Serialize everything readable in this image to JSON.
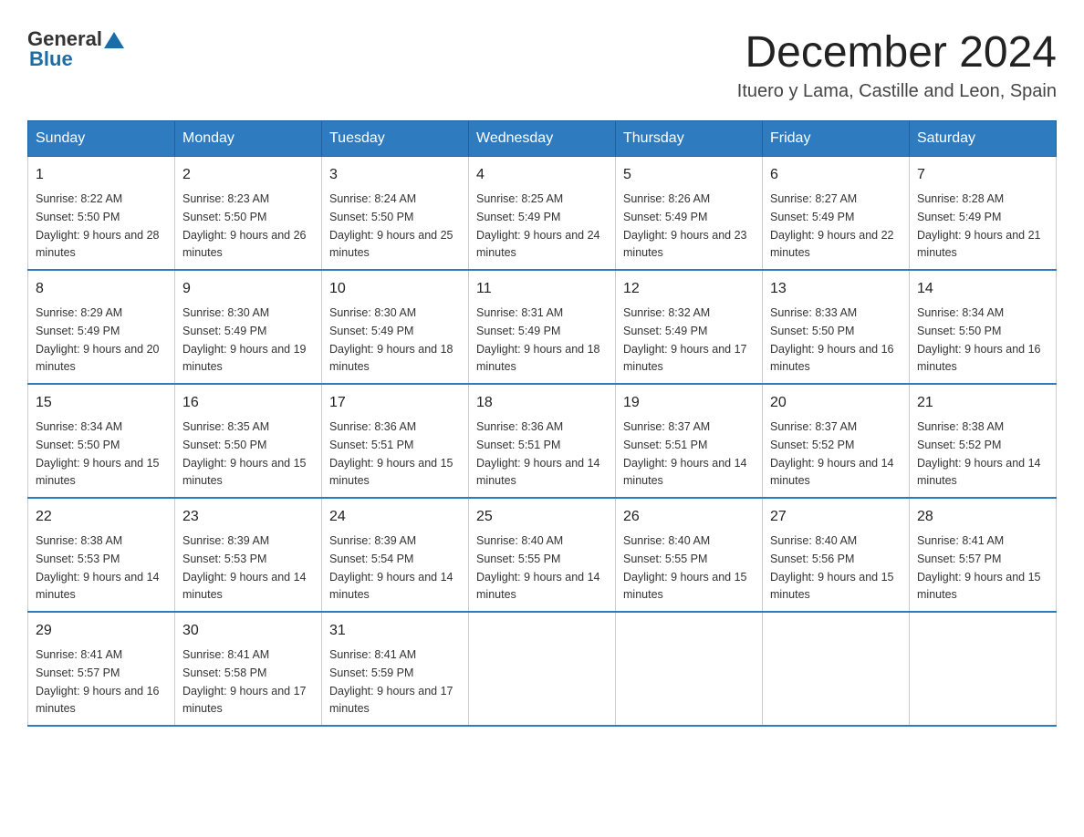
{
  "logo": {
    "general": "General",
    "blue": "Blue"
  },
  "title": "December 2024",
  "subtitle": "Ituero y Lama, Castille and Leon, Spain",
  "days_of_week": [
    "Sunday",
    "Monday",
    "Tuesday",
    "Wednesday",
    "Thursday",
    "Friday",
    "Saturday"
  ],
  "weeks": [
    [
      {
        "day": "1",
        "sunrise": "8:22 AM",
        "sunset": "5:50 PM",
        "daylight": "9 hours and 28 minutes."
      },
      {
        "day": "2",
        "sunrise": "8:23 AM",
        "sunset": "5:50 PM",
        "daylight": "9 hours and 26 minutes."
      },
      {
        "day": "3",
        "sunrise": "8:24 AM",
        "sunset": "5:50 PM",
        "daylight": "9 hours and 25 minutes."
      },
      {
        "day": "4",
        "sunrise": "8:25 AM",
        "sunset": "5:49 PM",
        "daylight": "9 hours and 24 minutes."
      },
      {
        "day": "5",
        "sunrise": "8:26 AM",
        "sunset": "5:49 PM",
        "daylight": "9 hours and 23 minutes."
      },
      {
        "day": "6",
        "sunrise": "8:27 AM",
        "sunset": "5:49 PM",
        "daylight": "9 hours and 22 minutes."
      },
      {
        "day": "7",
        "sunrise": "8:28 AM",
        "sunset": "5:49 PM",
        "daylight": "9 hours and 21 minutes."
      }
    ],
    [
      {
        "day": "8",
        "sunrise": "8:29 AM",
        "sunset": "5:49 PM",
        "daylight": "9 hours and 20 minutes."
      },
      {
        "day": "9",
        "sunrise": "8:30 AM",
        "sunset": "5:49 PM",
        "daylight": "9 hours and 19 minutes."
      },
      {
        "day": "10",
        "sunrise": "8:30 AM",
        "sunset": "5:49 PM",
        "daylight": "9 hours and 18 minutes."
      },
      {
        "day": "11",
        "sunrise": "8:31 AM",
        "sunset": "5:49 PM",
        "daylight": "9 hours and 18 minutes."
      },
      {
        "day": "12",
        "sunrise": "8:32 AM",
        "sunset": "5:49 PM",
        "daylight": "9 hours and 17 minutes."
      },
      {
        "day": "13",
        "sunrise": "8:33 AM",
        "sunset": "5:50 PM",
        "daylight": "9 hours and 16 minutes."
      },
      {
        "day": "14",
        "sunrise": "8:34 AM",
        "sunset": "5:50 PM",
        "daylight": "9 hours and 16 minutes."
      }
    ],
    [
      {
        "day": "15",
        "sunrise": "8:34 AM",
        "sunset": "5:50 PM",
        "daylight": "9 hours and 15 minutes."
      },
      {
        "day": "16",
        "sunrise": "8:35 AM",
        "sunset": "5:50 PM",
        "daylight": "9 hours and 15 minutes."
      },
      {
        "day": "17",
        "sunrise": "8:36 AM",
        "sunset": "5:51 PM",
        "daylight": "9 hours and 15 minutes."
      },
      {
        "day": "18",
        "sunrise": "8:36 AM",
        "sunset": "5:51 PM",
        "daylight": "9 hours and 14 minutes."
      },
      {
        "day": "19",
        "sunrise": "8:37 AM",
        "sunset": "5:51 PM",
        "daylight": "9 hours and 14 minutes."
      },
      {
        "day": "20",
        "sunrise": "8:37 AM",
        "sunset": "5:52 PM",
        "daylight": "9 hours and 14 minutes."
      },
      {
        "day": "21",
        "sunrise": "8:38 AM",
        "sunset": "5:52 PM",
        "daylight": "9 hours and 14 minutes."
      }
    ],
    [
      {
        "day": "22",
        "sunrise": "8:38 AM",
        "sunset": "5:53 PM",
        "daylight": "9 hours and 14 minutes."
      },
      {
        "day": "23",
        "sunrise": "8:39 AM",
        "sunset": "5:53 PM",
        "daylight": "9 hours and 14 minutes."
      },
      {
        "day": "24",
        "sunrise": "8:39 AM",
        "sunset": "5:54 PM",
        "daylight": "9 hours and 14 minutes."
      },
      {
        "day": "25",
        "sunrise": "8:40 AM",
        "sunset": "5:55 PM",
        "daylight": "9 hours and 14 minutes."
      },
      {
        "day": "26",
        "sunrise": "8:40 AM",
        "sunset": "5:55 PM",
        "daylight": "9 hours and 15 minutes."
      },
      {
        "day": "27",
        "sunrise": "8:40 AM",
        "sunset": "5:56 PM",
        "daylight": "9 hours and 15 minutes."
      },
      {
        "day": "28",
        "sunrise": "8:41 AM",
        "sunset": "5:57 PM",
        "daylight": "9 hours and 15 minutes."
      }
    ],
    [
      {
        "day": "29",
        "sunrise": "8:41 AM",
        "sunset": "5:57 PM",
        "daylight": "9 hours and 16 minutes."
      },
      {
        "day": "30",
        "sunrise": "8:41 AM",
        "sunset": "5:58 PM",
        "daylight": "9 hours and 17 minutes."
      },
      {
        "day": "31",
        "sunrise": "8:41 AM",
        "sunset": "5:59 PM",
        "daylight": "9 hours and 17 minutes."
      },
      null,
      null,
      null,
      null
    ]
  ]
}
